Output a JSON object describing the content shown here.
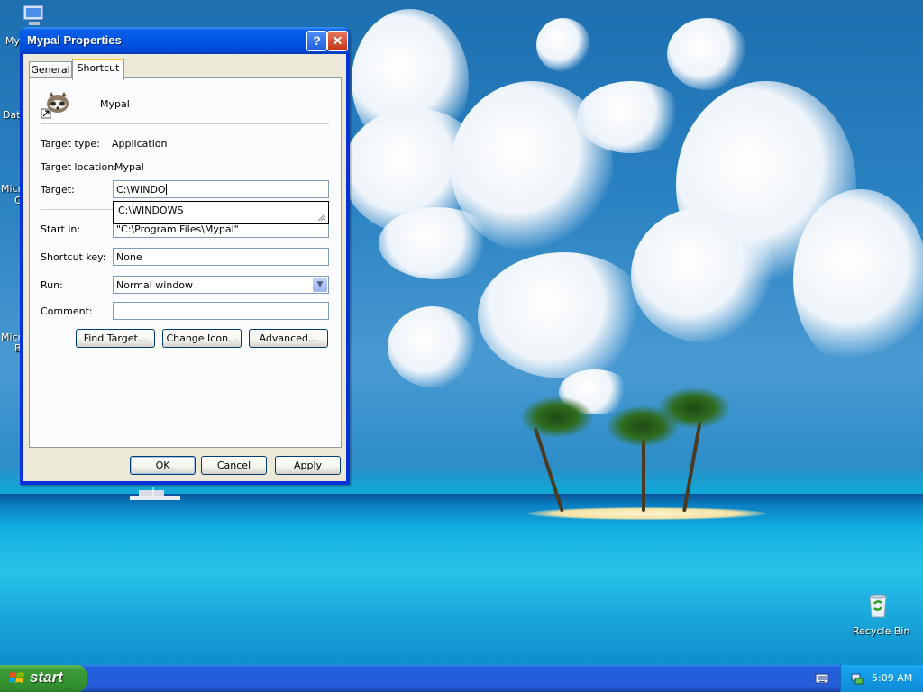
{
  "desktop": {
    "icons": [
      {
        "label": "My"
      },
      {
        "label": "Dat"
      },
      {
        "label": "Micro"
      },
      {
        "label": "C"
      },
      {
        "label": "Micro"
      },
      {
        "label": "B"
      }
    ],
    "recycle_bin_label": "Recycle Bin"
  },
  "window": {
    "title": "Mypal Properties",
    "help_label": "?",
    "close_label": "✕",
    "tabs": [
      {
        "label": "General",
        "active": false
      },
      {
        "label": "Shortcut",
        "active": true
      }
    ],
    "app_name": "Mypal",
    "target_type_label": "Target type:",
    "target_type_value": "Application",
    "target_location_label": "Target location:",
    "target_location_value": "Mypal",
    "target_label": "Target:",
    "target_value": "C:\\WINDO",
    "autocomplete_suggestion": "C:\\WINDOWS",
    "start_in_label": "Start in:",
    "start_in_value": "\"C:\\Program Files\\Mypal\"",
    "shortcut_key_label": "Shortcut key:",
    "shortcut_key_value": "None",
    "run_label": "Run:",
    "run_value": "Normal window",
    "comment_label": "Comment:",
    "comment_value": "",
    "find_target_label": "Find Target...",
    "change_icon_label": "Change Icon...",
    "advanced_label": "Advanced...",
    "ok_label": "OK",
    "cancel_label": "Cancel",
    "apply_label": "Apply"
  },
  "taskbar": {
    "start_label": "start",
    "clock": "5:09 AM"
  },
  "colors": {
    "titlebar": "#0055e5",
    "taskbar": "#245edb",
    "start_button": "#3c9a37",
    "dialog_face": "#ece9d8"
  }
}
